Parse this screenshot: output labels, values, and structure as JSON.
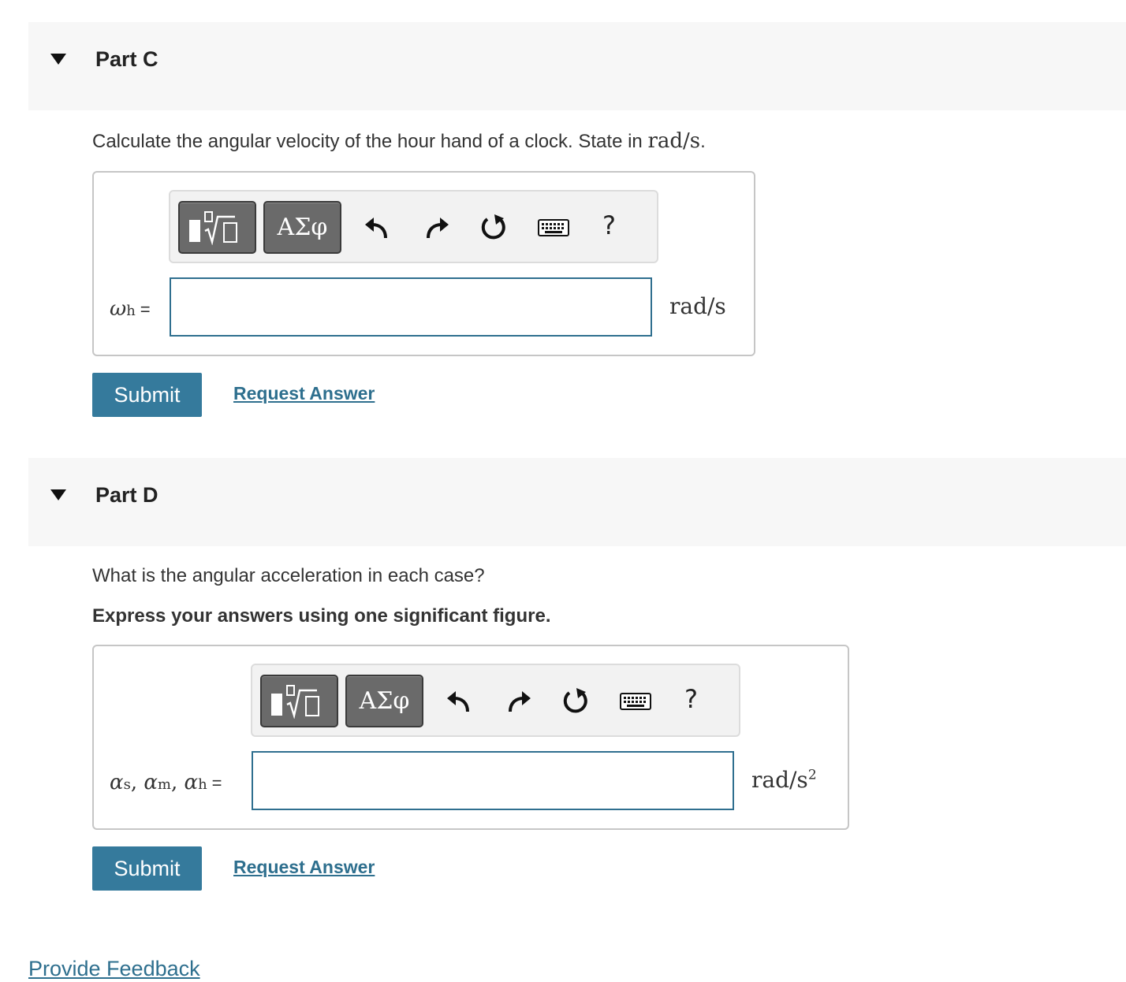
{
  "part_c": {
    "title": "Part C",
    "question": "Calculate the angular velocity of the hour hand of a clock. State in ",
    "question_unit": "rad/s",
    "question_end": ".",
    "toolbar": {
      "greek_label": "ΑΣφ",
      "help_label": "?"
    },
    "var_symbol": "ω",
    "var_sub": "h",
    "equals": "=",
    "input_value": "",
    "unit": "rad/s",
    "submit_label": "Submit",
    "request_label": "Request Answer"
  },
  "part_d": {
    "title": "Part D",
    "question": "What is the angular acceleration in each case?",
    "instruction": "Express your answers using one significant figure.",
    "toolbar": {
      "greek_label": "ΑΣφ",
      "help_label": "?"
    },
    "var_symbol": "α",
    "var_sub_1": "s",
    "var_sub_2": "m",
    "var_sub_3": "h",
    "comma": ",",
    "equals": "=",
    "input_value": "",
    "unit_base": "rad/s",
    "unit_exp": "2",
    "submit_label": "Submit",
    "request_label": "Request Answer"
  },
  "feedback_label": "Provide Feedback",
  "colors": {
    "primary": "#357a9c",
    "link": "#2e6f8e",
    "header_bg": "#f7f7f7",
    "input_border": "#2f6f8f"
  },
  "icons": [
    "caret-down-icon",
    "templates-icon",
    "undo-icon",
    "redo-icon",
    "reset-icon",
    "keyboard-icon",
    "help-icon"
  ]
}
